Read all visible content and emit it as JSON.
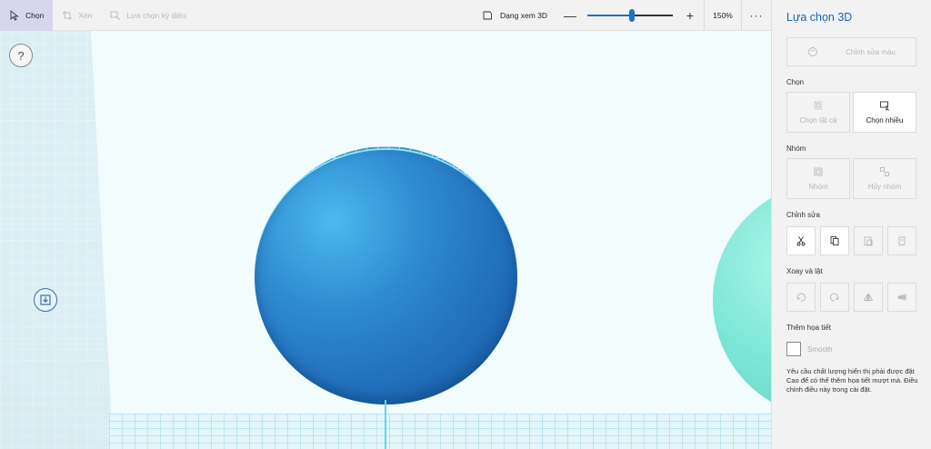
{
  "toolbar": {
    "select_label": "Chọn",
    "crop_label": "Xén",
    "magic_select_label": "Lựa chọn kỳ diệu",
    "view3d_label": "Dạng xem 3D",
    "zoom_minus": "—",
    "zoom_plus": "+",
    "zoom_value": "150%",
    "zoom_level_fraction": 0.52,
    "more": "···"
  },
  "canvas": {
    "help_label": "?"
  },
  "panel": {
    "title": "Lựa chọn 3D",
    "edit_color": "Chỉnh sửa màu",
    "select_section": "Chọn",
    "select_all": "Chọn tất cả",
    "multi_select": "Chọn nhiều",
    "group_section": "Nhóm",
    "group": "Nhóm",
    "ungroup": "Hủy nhóm",
    "edit_section": "Chỉnh sửa",
    "rotate_section": "Xoay và lật",
    "detail_section": "Thêm họa tiết",
    "smooth_label": "Smooth",
    "note": "Yêu cầu chất lượng hiển thị phải được đặt Cao để có thể thêm họa tiết mượt mà. Điều chỉnh điều này trong cài đặt.",
    "accent_color": "#1d64b1"
  }
}
